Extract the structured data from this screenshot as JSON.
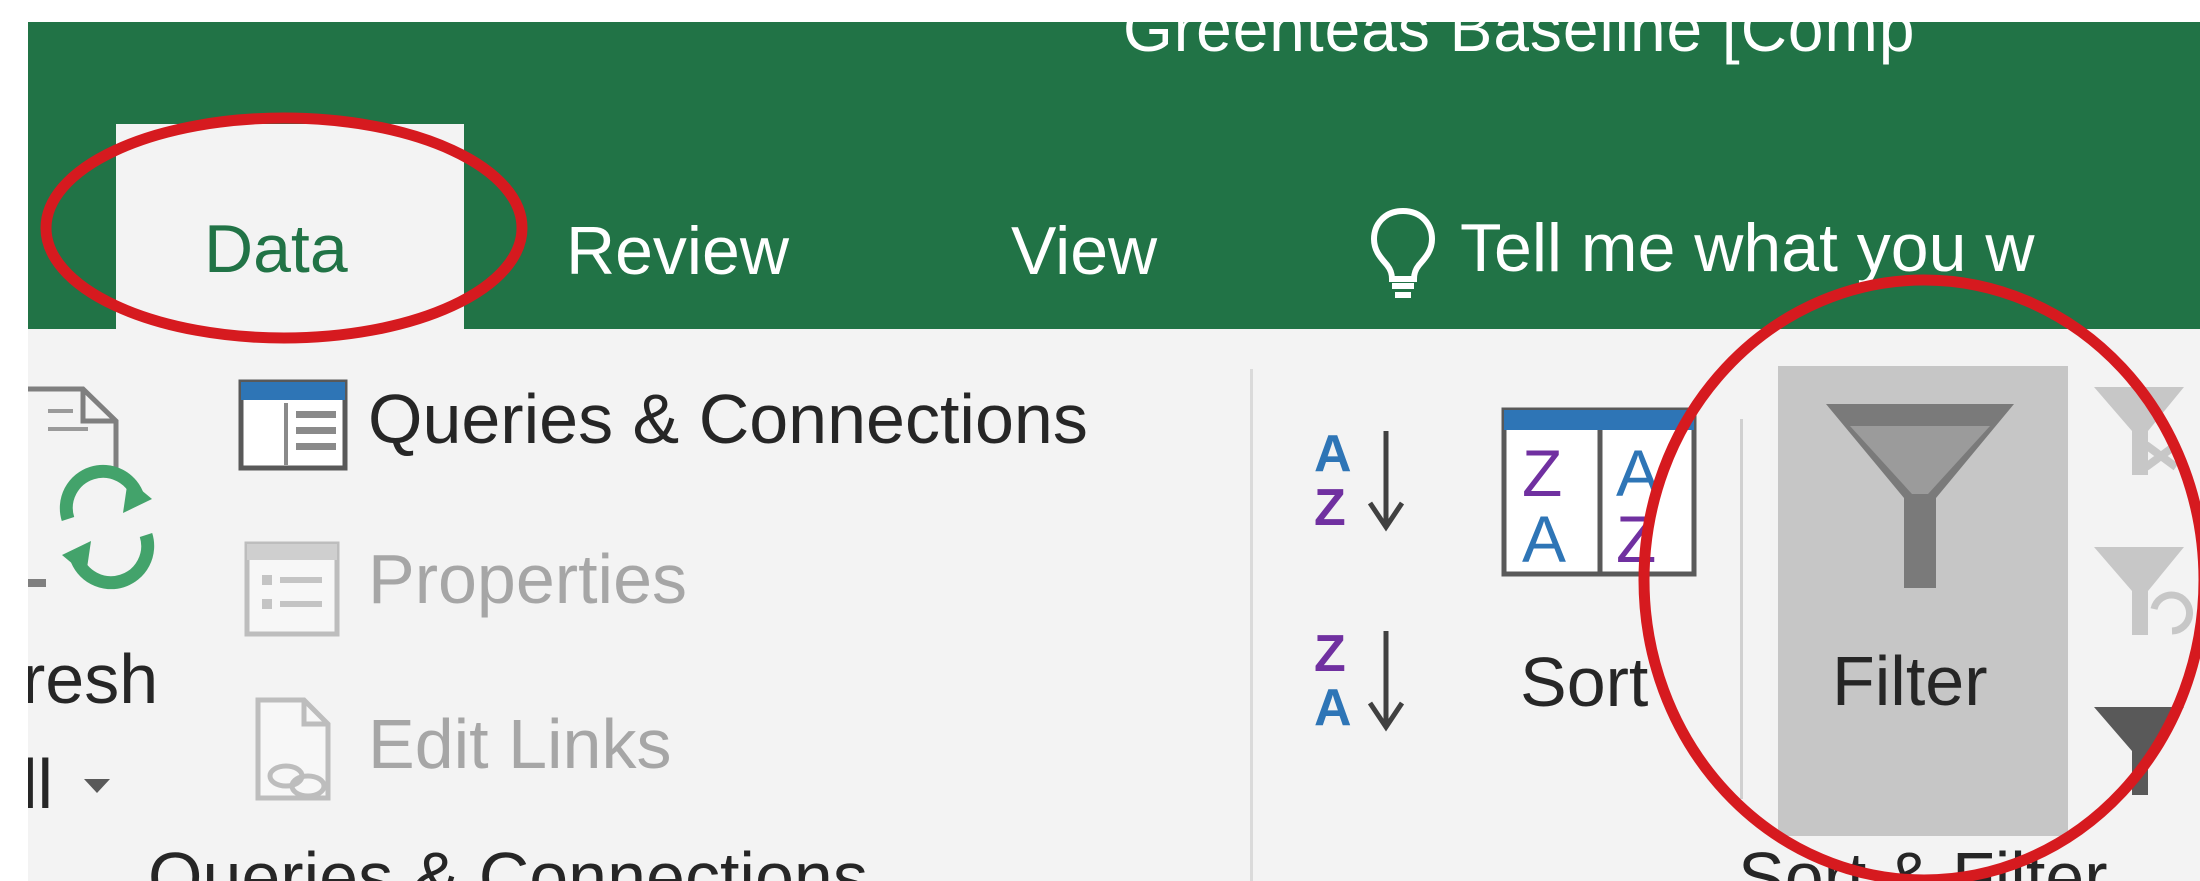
{
  "window_title": "Greenteas Baseline [Comp",
  "tabs": {
    "data": "Data",
    "review": "Review",
    "view": "View"
  },
  "tell_me": "Tell me what you w",
  "ribbon": {
    "refresh_top": "resh",
    "refresh_bottom": "ll",
    "queries_connections": "Queries & Connections",
    "properties": "Properties",
    "edit_links": "Edit Links",
    "sort": "Sort",
    "filter": "Filter",
    "group_label_queries": "Queries & Connections",
    "group_label_sort": "Sort & Filter"
  },
  "colors": {
    "excel_green": "#217346",
    "annotation_red": "#d61a1f",
    "filter_active_bg": "#c6c6c6"
  }
}
